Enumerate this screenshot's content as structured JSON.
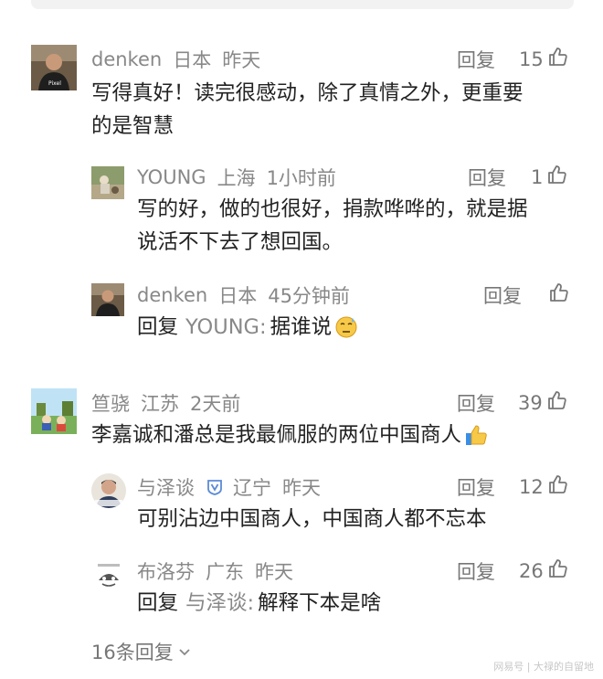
{
  "comments": [
    {
      "user": "denken",
      "location": "日本",
      "time": "昨天",
      "reply_label": "回复",
      "likes": "15",
      "line1": "写得真好！读完很感动，除了真情之外，更重要",
      "line2": "的是智慧"
    },
    {
      "user": "YOUNG",
      "location": "上海",
      "time": "1小时前",
      "reply_label": "回复",
      "likes": "1",
      "line1": "写的好，做的也很好，捐款哗哗的，就是据",
      "line2": "说活不下去了想回国。"
    },
    {
      "user": "denken",
      "location": "日本",
      "time": "45分钟前",
      "reply_label": "回复",
      "prefix": "回复",
      "mention": "YOUNG:",
      "text": "据谁说",
      "emoji": "sweat-face"
    },
    {
      "user": "笪骁",
      "location": "江苏",
      "time": "2天前",
      "reply_label": "回复",
      "likes": "39",
      "text": "李嘉诚和潘总是我最佩服的两位中国商人",
      "emoji": "thumbs-up"
    },
    {
      "user": "与泽谈",
      "location": "辽宁",
      "time": "昨天",
      "reply_label": "回复",
      "likes": "12",
      "text": "可别沾边中国商人，中国商人都不忘本"
    },
    {
      "user": "布洛芬",
      "location": "广东",
      "time": "昨天",
      "reply_label": "回复",
      "likes": "26",
      "prefix": "回复",
      "mention": "与泽谈:",
      "text": "解释下本是啥"
    }
  ],
  "more_replies": "16条回复",
  "watermark": "网易号 | 大禄的自留地",
  "colors": {
    "meta_gray": "#888888",
    "text": "#222222",
    "badge_blue": "#5b8bd6"
  }
}
